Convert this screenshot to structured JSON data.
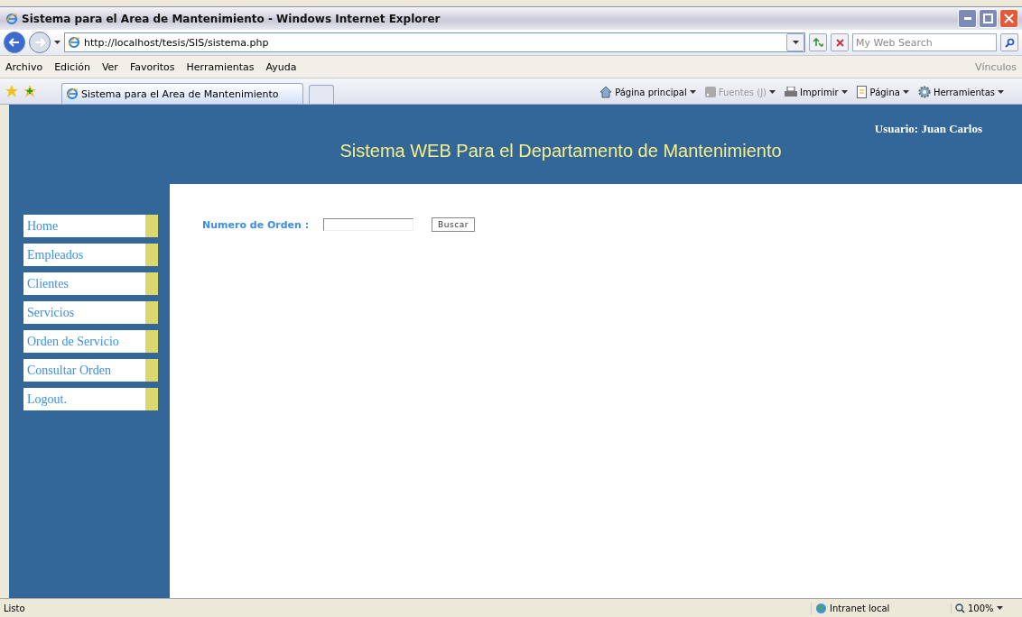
{
  "window": {
    "title": "Sistema para el Area de Mantenimiento - Windows Internet Explorer"
  },
  "address_bar": {
    "url": "http://localhost/tesis/SIS/sistema.php"
  },
  "search": {
    "placeholder": "My Web Search"
  },
  "menu": [
    "Archivo",
    "Edición",
    "Ver",
    "Favoritos",
    "Herramientas",
    "Ayuda"
  ],
  "links_label": "Vínculos",
  "tab": {
    "title": "Sistema para el Area de Mantenimiento"
  },
  "commands": [
    {
      "kind": "home",
      "label": "Página principal",
      "disabled": false
    },
    {
      "kind": "feeds",
      "label": "Fuentes (J)",
      "disabled": true
    },
    {
      "kind": "print",
      "label": "Imprimir",
      "disabled": false
    },
    {
      "kind": "page",
      "label": "Página",
      "disabled": false
    },
    {
      "kind": "tools",
      "label": "Herramientas",
      "disabled": false
    }
  ],
  "page": {
    "heading": "Sistema WEB Para el Departamento de Mantenimiento",
    "user": "Usuario: Juan Carlos",
    "nav": [
      "Home",
      "Empleados",
      "Clientes",
      "Servicios",
      "Orden de Servicio",
      "Consultar Orden",
      "Logout."
    ],
    "form": {
      "label": "Numero de Orden :",
      "button": "Buscar"
    }
  },
  "status_bar": {
    "status": "Listo",
    "zone": "Intranet local",
    "zoom": "100%"
  }
}
